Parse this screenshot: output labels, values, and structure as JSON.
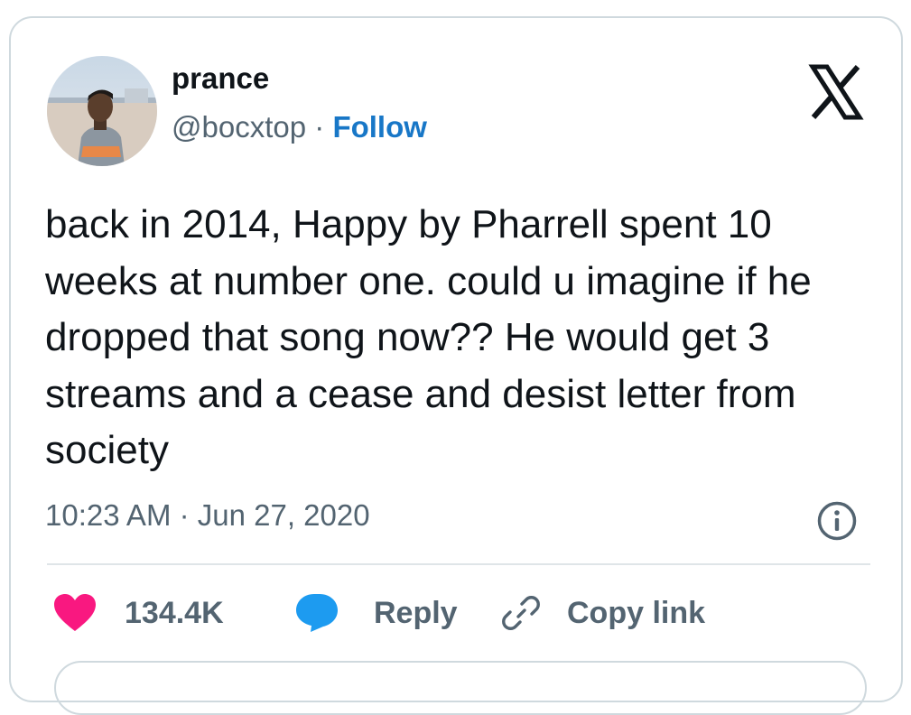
{
  "author": {
    "name": "prance",
    "handle": "@bocxtop",
    "separator": "·",
    "follow_label": "Follow"
  },
  "tweet": {
    "text": "back in 2014, Happy by Pharrell spent 10 weeks at number one. could u imagine if he dropped that song now?? He would get 3 streams and a cease and desist letter from society",
    "timestamp": "10:23 AM · Jun 27, 2020"
  },
  "actions": {
    "like_count": "134.4K",
    "reply_label": "Reply",
    "copy_link_label": "Copy link"
  },
  "icons": {
    "brand": "x-logo-icon",
    "info": "info-icon",
    "like": "heart-icon",
    "reply": "speech-bubble-icon",
    "copy": "link-icon"
  },
  "colors": {
    "follow": "#1877c7",
    "heart": "#f91880",
    "reply_bubble": "#1d9bf0",
    "muted_text": "#536471",
    "body_text": "#0f1419"
  }
}
